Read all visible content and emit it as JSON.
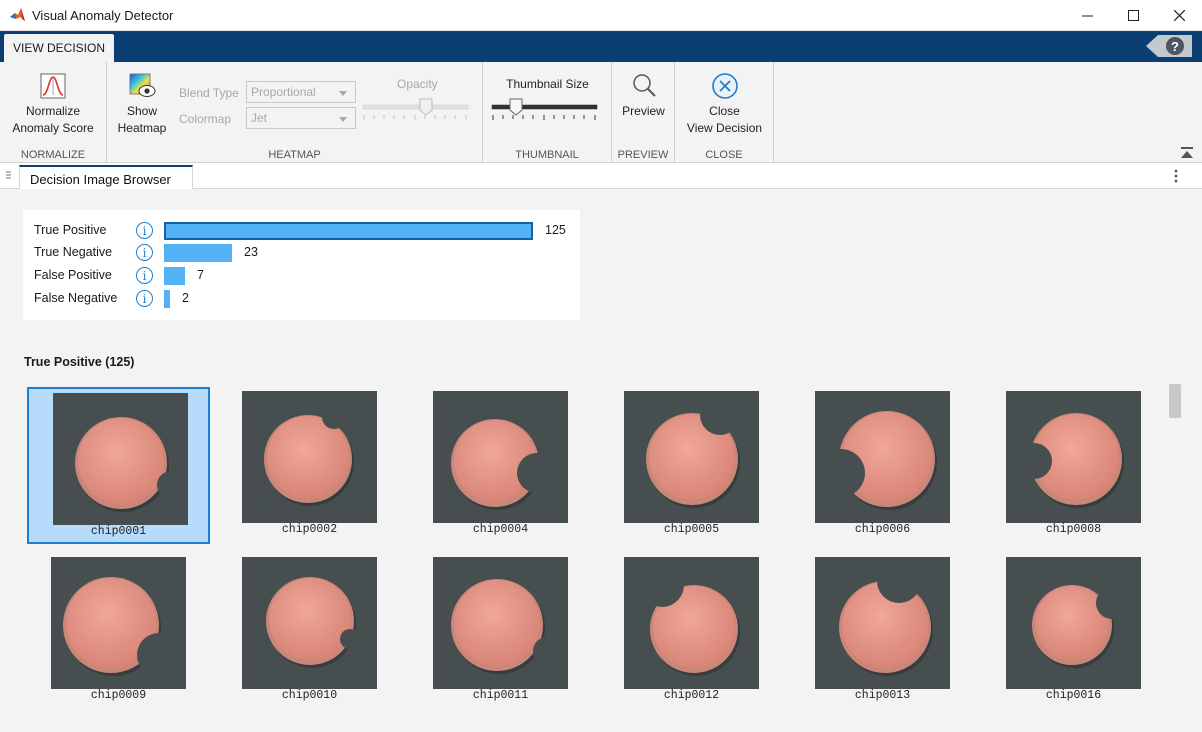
{
  "window": {
    "title": "Visual Anomaly Detector",
    "accent": "#0b3f73"
  },
  "toolstrip": {
    "tab_label": "VIEW DECISION",
    "normalize": {
      "button_label_1": "Normalize",
      "button_label_2": "Anomaly Score",
      "section_label": "NORMALIZE"
    },
    "heatmap": {
      "show_label_1": "Show",
      "show_label_2": "Heatmap",
      "blend_label": "Blend Type",
      "blend_value": "Proportional",
      "colormap_label": "Colormap",
      "colormap_value": "Jet",
      "opacity_label": "Opacity",
      "section_label": "HEATMAP"
    },
    "thumbnail": {
      "size_label": "Thumbnail Size",
      "section_label": "THUMBNAIL"
    },
    "preview": {
      "button_label": "Preview",
      "section_label": "PREVIEW"
    },
    "close": {
      "button_label_1": "Close",
      "button_label_2": "View Decision",
      "section_label": "CLOSE"
    }
  },
  "document": {
    "tab_label": "Decision Image Browser"
  },
  "summary": {
    "info_glyph": "i",
    "rows": [
      {
        "label": "True Positive",
        "count": 125,
        "count_text": "125",
        "selected": true
      },
      {
        "label": "True Negative",
        "count": 23,
        "count_text": "23",
        "selected": false
      },
      {
        "label": "False Positive",
        "count": 7,
        "count_text": "7",
        "selected": false
      },
      {
        "label": "False Negative",
        "count": 2,
        "count_text": "2",
        "selected": false
      }
    ],
    "bar_color": "#53b2f5"
  },
  "group": {
    "title": "True Positive (125)"
  },
  "thumbnails": [
    {
      "name": "chip0001",
      "selected": true
    },
    {
      "name": "chip0002",
      "selected": false
    },
    {
      "name": "chip0004",
      "selected": false
    },
    {
      "name": "chip0005",
      "selected": false
    },
    {
      "name": "chip0006",
      "selected": false
    },
    {
      "name": "chip0008",
      "selected": false
    },
    {
      "name": "chip0009",
      "selected": false
    },
    {
      "name": "chip0010",
      "selected": false
    },
    {
      "name": "chip0011",
      "selected": false
    },
    {
      "name": "chip0012",
      "selected": false
    },
    {
      "name": "chip0013",
      "selected": false
    },
    {
      "name": "chip0016",
      "selected": false
    }
  ]
}
